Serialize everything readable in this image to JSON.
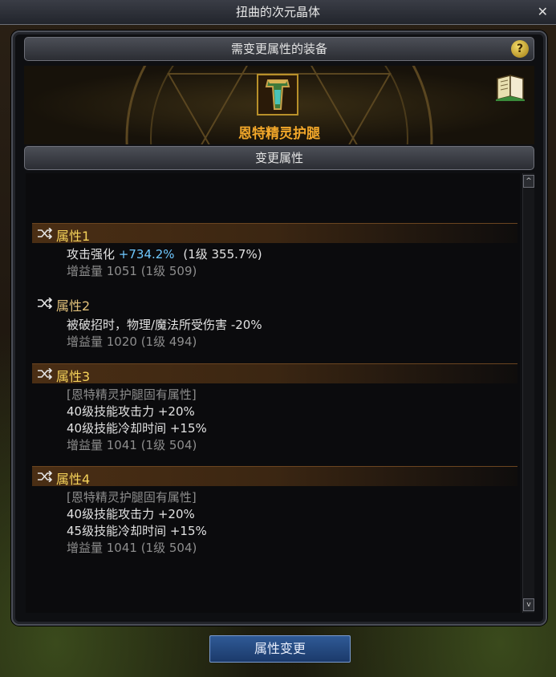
{
  "window": {
    "title": "扭曲的次元晶体",
    "close_label": "✕"
  },
  "equip_section": {
    "title": "需变更属性的装备",
    "help_label": "?"
  },
  "equipment": {
    "name": "恩特精灵护腿"
  },
  "change_section": {
    "title": "变更属性"
  },
  "attributes": [
    {
      "title": "属性1",
      "line1": "攻击强化",
      "line1_value": "+734.2%",
      "line1_extra": "(1级 355.7%)",
      "gain": "增益量 1051 (1级 509)"
    },
    {
      "title": "属性2",
      "line1": "被破招时，物理/魔法所受伤害 -20%",
      "gain": "增益量 1020 (1级 494)"
    },
    {
      "title": "属性3",
      "tag": "[恩特精灵护腿固有属性]",
      "line1": "40级技能攻击力 +20%",
      "line2": "40级技能冷却时间 +15%",
      "gain": "增益量 1041 (1级 504)"
    },
    {
      "title": "属性4",
      "tag": "[恩特精灵护腿固有属性]",
      "line1": "40级技能攻击力 +20%",
      "line2": "45级技能冷却时间 +15%",
      "gain": "增益量 1041 (1级 504)"
    }
  ],
  "actions": {
    "confirm_label": "属性变更"
  },
  "scroll": {
    "up": "^",
    "down": "v"
  },
  "icons": {
    "shuffle": "shuffle-icon",
    "book": "book-icon",
    "help": "help-icon",
    "equip": "leg-armor-icon"
  },
  "colors": {
    "accent": "#f2a72a",
    "highlight": "#6fc8ff",
    "attr_title": "#f5d25a"
  }
}
